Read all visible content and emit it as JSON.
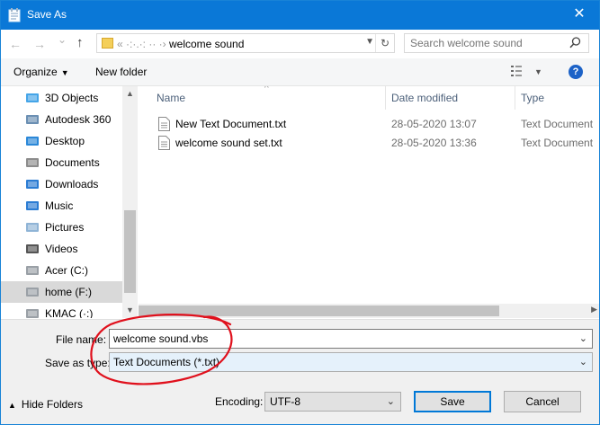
{
  "window": {
    "title": "Save As",
    "close_glyph": "✕"
  },
  "nav": {
    "back_glyph": "←",
    "forward_glyph": "→",
    "recent_glyph": "⌄",
    "up_glyph": "↑",
    "address": {
      "prefix": "«",
      "obscured_path": " ·:·.·: ·· ·› ",
      "separator": "›",
      "current": "welcome sound"
    },
    "refresh_glyph": "↻",
    "search": {
      "placeholder": "Search welcome sound"
    }
  },
  "toolbar": {
    "organize_label": "Organize",
    "new_folder_label": "New folder",
    "help_label": "?"
  },
  "nav_pane": {
    "items": [
      {
        "label": "3D Objects",
        "icon": "3d-objects-icon"
      },
      {
        "label": "Autodesk 360",
        "icon": "autodesk-360-icon"
      },
      {
        "label": "Desktop",
        "icon": "desktop-icon"
      },
      {
        "label": "Documents",
        "icon": "documents-icon"
      },
      {
        "label": "Downloads",
        "icon": "downloads-icon"
      },
      {
        "label": "Music",
        "icon": "music-icon"
      },
      {
        "label": "Pictures",
        "icon": "pictures-icon"
      },
      {
        "label": "Videos",
        "icon": "videos-icon"
      },
      {
        "label": "Acer (C:)",
        "icon": "drive-icon"
      },
      {
        "label": "home (F:)",
        "icon": "drive-icon",
        "selected": true
      },
      {
        "label": "KMAC (·:)",
        "icon": "drive-icon"
      }
    ]
  },
  "file_list": {
    "columns": [
      "Name",
      "Date modified",
      "Type"
    ],
    "rows": [
      {
        "name": "New Text Document.txt",
        "date": "28-05-2020 13:07",
        "type": "Text Document"
      },
      {
        "name": "welcome sound set.txt",
        "date": "28-05-2020 13:36",
        "type": "Text Document"
      }
    ]
  },
  "save_panel": {
    "file_name_label": "File name:",
    "file_name_value": "welcome sound.vbs",
    "save_as_type_label": "Save as type:",
    "save_as_type_value": "Text Documents (*.txt)",
    "hide_folders_label": "Hide Folders",
    "encoding_label": "Encoding:",
    "encoding_value": "UTF-8",
    "save_label": "Save",
    "cancel_label": "Cancel"
  },
  "colors": {
    "titlebar": "#0a78d7",
    "selection": "#d9d9d9",
    "annotation": "#e0101c"
  }
}
